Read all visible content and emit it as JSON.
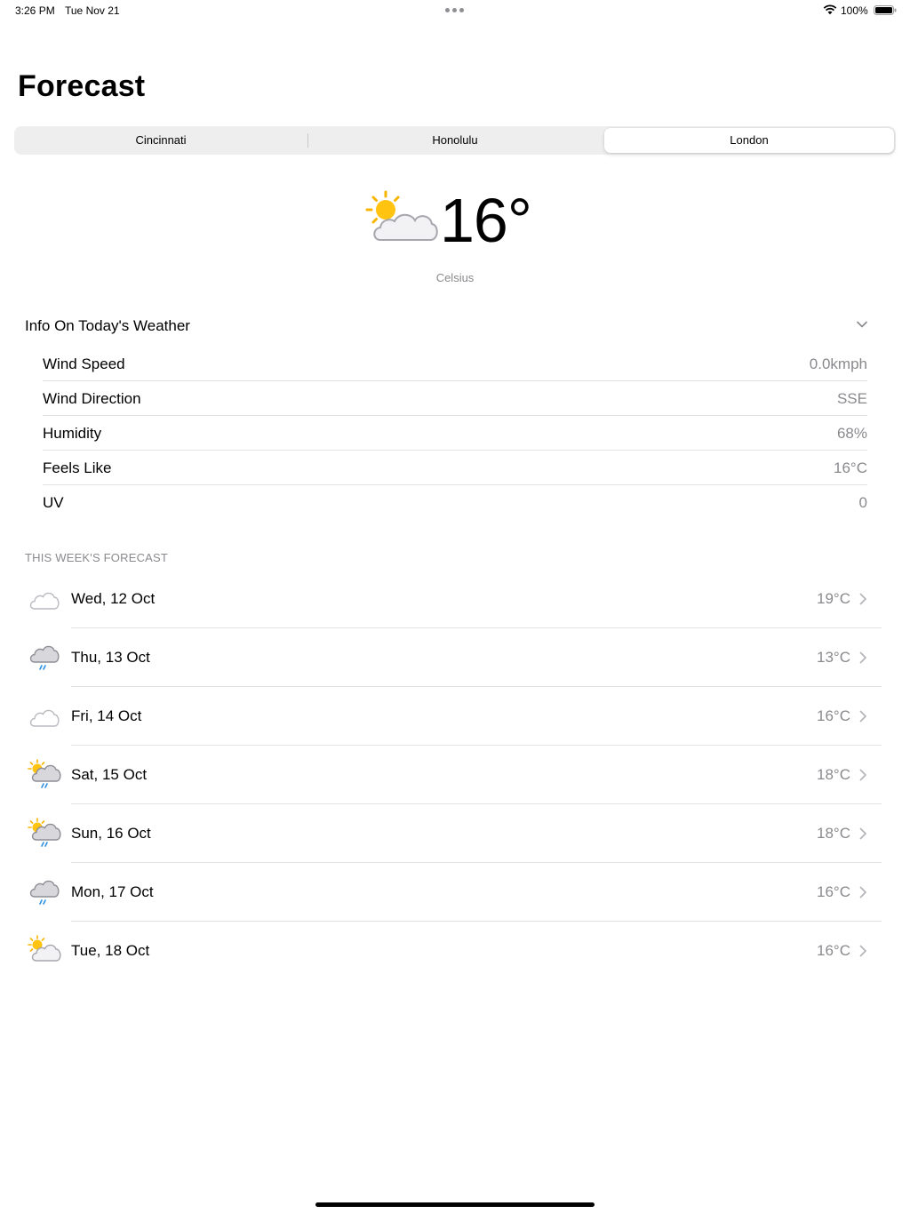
{
  "status_bar": {
    "time": "3:26 PM",
    "date": "Tue Nov 21",
    "battery": "100%"
  },
  "header": {
    "title": "Forecast"
  },
  "segments": {
    "items": [
      "Cincinnati",
      "Honolulu",
      "London"
    ],
    "selected": "London"
  },
  "current": {
    "temperature": "16°",
    "unit_label": "Celsius",
    "icon": "partly-cloudy-icon"
  },
  "info": {
    "title": "Info On Today's Weather",
    "rows": [
      {
        "label": "Wind Speed",
        "value": "0.0kmph"
      },
      {
        "label": "Wind Direction",
        "value": "SSE"
      },
      {
        "label": "Humidity",
        "value": "68%"
      },
      {
        "label": "Feels Like",
        "value": "16°C"
      },
      {
        "label": "UV",
        "value": "0"
      }
    ]
  },
  "forecast": {
    "section_title": "THIS WEEK'S FORECAST",
    "days": [
      {
        "date": "Wed, 12 Oct",
        "temp": "19°C",
        "icon": "cloud-icon"
      },
      {
        "date": "Thu, 13 Oct",
        "temp": "13°C",
        "icon": "rain-cloud-icon"
      },
      {
        "date": "Fri, 14 Oct",
        "temp": "16°C",
        "icon": "cloud-icon"
      },
      {
        "date": "Sat, 15 Oct",
        "temp": "18°C",
        "icon": "sun-rain-cloud-icon"
      },
      {
        "date": "Sun, 16 Oct",
        "temp": "18°C",
        "icon": "sun-rain-cloud-icon"
      },
      {
        "date": "Mon, 17 Oct",
        "temp": "16°C",
        "icon": "rain-cloud-icon"
      },
      {
        "date": "Tue, 18 Oct",
        "temp": "16°C",
        "icon": "partly-cloudy-icon"
      }
    ]
  },
  "colors": {
    "accent_sun": "#f7b500",
    "rain": "#2d8fe0",
    "secondary_text": "#8a8a8e",
    "separator": "#e2e2e5"
  }
}
